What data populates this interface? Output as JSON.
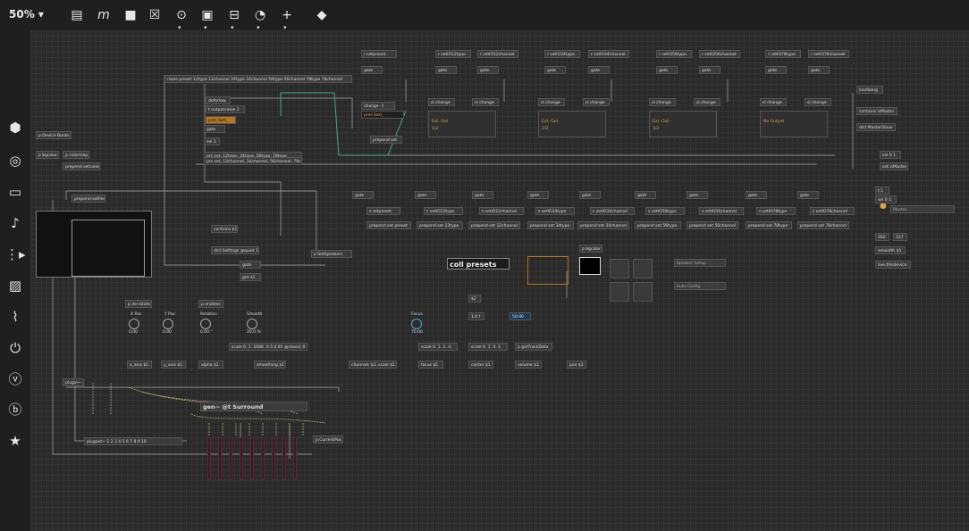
{
  "toolbar": {
    "zoom_label": "50% ▾",
    "icons": [
      "presentation-icon",
      "italic-m-icon",
      "comment-icon",
      "x-box-icon",
      "toggle-icon",
      "play-icon",
      "slider-icon",
      "dial-icon",
      "plus-icon",
      "paint-bucket-icon"
    ]
  },
  "sidebar": {
    "icons": [
      "cube-icon",
      "target-icon",
      "film-icon",
      "music-icon",
      "clip-icon",
      "image-icon",
      "paperclip-icon",
      "plug-icon",
      "vimeo-icon",
      "b-icon",
      "star-icon"
    ]
  },
  "objects": {
    "route_preset": "route preset 12type 12channel 34type 34channel 56type 56channel 78type 78channel",
    "p_device_banks": "p Device Banks",
    "p_bgcolor": "p bgcolor",
    "p_colormap": "p colormap",
    "prepend_setcolor": "prepend setcolor",
    "prepend_setpos": "prepend setPos",
    "deferlow": "deferlow",
    "t_outputvalue_1": "t outputvalue 1",
    "pres_set": "pres SetI_",
    "gate": "gate",
    "sel_1": "sel 1",
    "prs_set": "prs set, 12type, 34type, 56type, 78type",
    "prs_set2": "prs set, 12channel, 34channel, 56channel, 78channel",
    "contains_1": "contains $1",
    "dict_settings": "dict Settings @quiet 1",
    "p_setspeakers": "p SetSpeakers",
    "get_1": "get $1",
    "change_1": "change -1",
    "prepend_set": "prepend set",
    "s_setpreset": "r setpreset",
    "r_setio12type": "r setIO12type",
    "r_setio12channel": "r setIO12channel",
    "r_setio34type": "r setIO34type",
    "r_setio34channel": "r setIO34channel",
    "r_setio56type": "r setIO56type",
    "r_setio56channel": "r setIO56channel",
    "r_setio78type": "r setIO78type",
    "r_setio78channel": "r setIO78channel",
    "sl_change": "sl change",
    "ext_out": "Ext. Out",
    "ext_out_2": "1/2",
    "no_output": "No Output",
    "loadbang": "loadbang",
    "contains_ismaster": "contains isMaster",
    "dict_masterslave": "dict MasterSlave",
    "sel_0_1": "sel 0 1",
    "set_ismaster": "set isMaster",
    "s_setpreset2": "s setpreset",
    "s_setio12type": "s setIO12type",
    "s_setio12channel": "s setIO12channel",
    "s_setio34type": "s setIO34type",
    "s_setio34channel": "s setIO34channel",
    "s_setio56type": "s setIO56type",
    "s_setio56channel": "s setIO56channel",
    "s_setio78type": "s setIO78type",
    "s_setio78channel": "s setIO78channel",
    "pp_set_preset": "prepend set preset",
    "pp_set_12type": "prepend set 12type",
    "pp_set_12channel": "prepend set 12channel",
    "pp_set_34type": "prepend set 34type",
    "pp_set_34channel": "prepend set 34channel",
    "pp_set_56type": "prepend set 56type",
    "pp_set_56channel": "prepend set 56channel",
    "pp_set_78type": "prepend set 78type",
    "pp_set_78channel": "prepend set 78channel",
    "coll_presets": "coll presets",
    "p_bgcolor2": "p bgcolor",
    "speaker_setup": "Speaker Setup",
    "auto_config": "Auto Config",
    "p_de_rotate": "p de-rotate",
    "p_endless": "p endless",
    "x_pos": "X Pos",
    "y_pos": "Y Pos",
    "rotation": "Rotation",
    "smooth": "Smooth",
    "focus": "Focus",
    "val_0": "0.00",
    "val_0b": "0.00",
    "val_1": "0.00 °",
    "val_20": "20.0 %",
    "val_70": "70.00",
    "val_s": "50.00",
    "scale_smooth": "scale 0. 1. 1000. 0.5 0.05 @classic 0",
    "scale_014": "scale 0. 1. 1. 4.",
    "scale_0101": "scale 0. 1. 0. 1.",
    "p_gettrackdata": "p getTrackData",
    "x_axis": "x_axis $1",
    "y_axis": "y_axis $1",
    "alpha": "alpha $1",
    "smoothing": "smoothing $1",
    "channels": "channels $3, scale $1",
    "focus_1": "focus $1",
    "center_1": "center $1",
    "volume_1": "volume $1",
    "pan_1": "pan $1",
    "plugin": "plugin~",
    "gen_surround": "gen~ @t Surround",
    "plugout": "plugout~ 1 2 3 4 5 6 7 8 9 10",
    "p_currentpos": "p CurrentPos",
    "v_12": "$2",
    "v_1_6_f": "1.6 f",
    "t_1": "t 1",
    "sel_0_1b": "sel 0 1",
    "v_262": "262",
    "v_317": "317",
    "setwidth": "setwidth $1",
    "live_thisdevice": "live.thisdevice",
    "master_label": "Master"
  }
}
